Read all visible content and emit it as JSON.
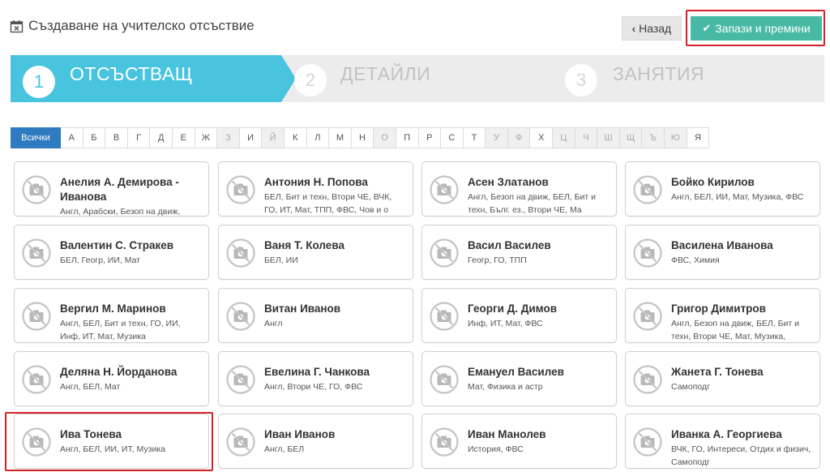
{
  "header": {
    "title": "Създаване на учителско отсъствие",
    "back_label": "Назад",
    "save_label": "Запази и премини"
  },
  "wizard": {
    "steps": [
      {
        "num": "1",
        "label": "ОТСЪСТВАЩ",
        "active": true
      },
      {
        "num": "2",
        "label": "ДЕТАЙЛИ",
        "active": false
      },
      {
        "num": "3",
        "label": "ЗАНЯТИЯ",
        "active": false
      }
    ]
  },
  "alphabet": {
    "all_label": "Всички",
    "letters": [
      "А",
      "Б",
      "В",
      "Г",
      "Д",
      "Е",
      "Ж",
      "З",
      "И",
      "Й",
      "К",
      "Л",
      "М",
      "Н",
      "О",
      "П",
      "Р",
      "С",
      "Т",
      "У",
      "Ф",
      "Х",
      "Ц",
      "Ч",
      "Ш",
      "Щ",
      "Ъ",
      "Ю",
      "Я"
    ],
    "disabled": [
      "З",
      "Й",
      "О",
      "У",
      "Ф",
      "Ц",
      "Ч",
      "Ш",
      "Щ",
      "Ъ",
      "Ю"
    ]
  },
  "teachers": [
    {
      "name": "Анелия А. Демирова - Иванова",
      "subjects": "Англ, Арабски, Безоп на движ,"
    },
    {
      "name": "Антония Н. Попова",
      "subjects": "БЕЛ, Бит и техн, Втори ЧЕ, ВЧК, ГО, ИТ, Мат, ТПП, ФВС, Чов и о"
    },
    {
      "name": "Асен Златанов",
      "subjects": "Англ, Безоп на движ, БЕЛ, Бит и техн, Бълг. ез., Втори ЧЕ, Ма"
    },
    {
      "name": "Бойко Кирилов",
      "subjects": "Англ, БЕЛ, ИИ, Мат, Музика, ФВС"
    },
    {
      "name": "Валентин С. Стракев",
      "subjects": "БЕЛ, Геогр, ИИ, Мат"
    },
    {
      "name": "Ваня Т. Колева",
      "subjects": "БЕЛ, ИИ"
    },
    {
      "name": "Васил Василев",
      "subjects": "Геогр, ГО, ТПП"
    },
    {
      "name": "Василена Иванова",
      "subjects": "ФВС, Химия"
    },
    {
      "name": "Вергил М. Маринов",
      "subjects": "Англ, БЕЛ, Бит и техн, ГО, ИИ, Инф, ИТ, Мат, Музика"
    },
    {
      "name": "Витан Иванов",
      "subjects": "Англ"
    },
    {
      "name": "Георги Д. Димов",
      "subjects": "Инф, ИТ, Мат, ФВС"
    },
    {
      "name": "Григор Димитров",
      "subjects": "Англ, Безоп на движ, БЕЛ, Бит и техн, Втори ЧЕ, Мат, Музика,"
    },
    {
      "name": "Деляна Н. Йорданова",
      "subjects": "Англ, БЕЛ, Мат"
    },
    {
      "name": "Евелина Г. Чанкова",
      "subjects": "Англ, Втори ЧЕ, ГО, ФВС"
    },
    {
      "name": "Емануел Василев",
      "subjects": "Мат, Физика и астр"
    },
    {
      "name": "Жанета Г. Тонева",
      "subjects": "Самоподг"
    },
    {
      "name": "Ива Тонева",
      "subjects": "Англ, БЕЛ, ИИ, ИТ, Музика"
    },
    {
      "name": "Иван Иванов",
      "subjects": "Англ, БЕЛ"
    },
    {
      "name": "Иван Манолев",
      "subjects": "История, ФВС"
    },
    {
      "name": "Иванка А. Георгиева",
      "subjects": "ВЧК, ГО, Интереси, Отдих и физич, Самоподг"
    }
  ],
  "colors": {
    "accent_teal": "#48b9a4",
    "wizard_active": "#48c4de",
    "alpha_active": "#2f7bbf",
    "highlight_red": "#d71f26"
  }
}
